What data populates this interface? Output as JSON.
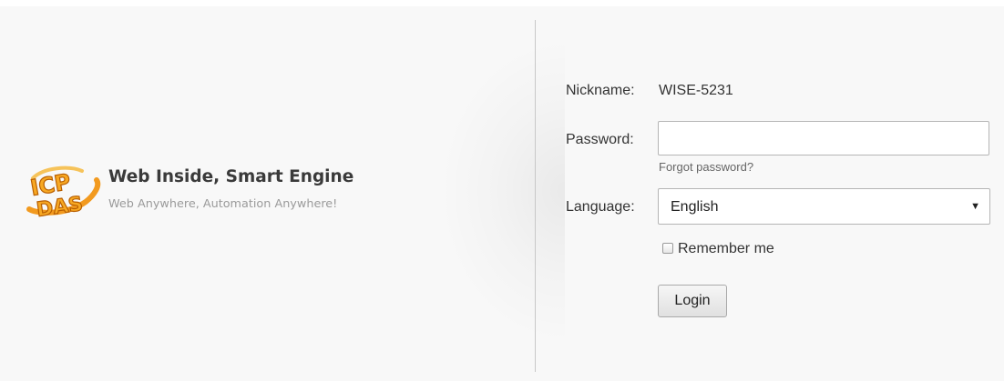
{
  "brand": {
    "logo_text": "ICP DAS",
    "title": "Web Inside, Smart Engine",
    "subtitle": "Web Anywhere, Automation Anywhere!"
  },
  "form": {
    "nickname_label": "Nickname:",
    "nickname_value": "WISE-5231",
    "password_label": "Password:",
    "password_value": "",
    "forgot_password": "Forgot password?",
    "language_label": "Language:",
    "language_value": "English",
    "remember_label": "Remember me",
    "remember_checked": false,
    "login_label": "Login"
  }
}
